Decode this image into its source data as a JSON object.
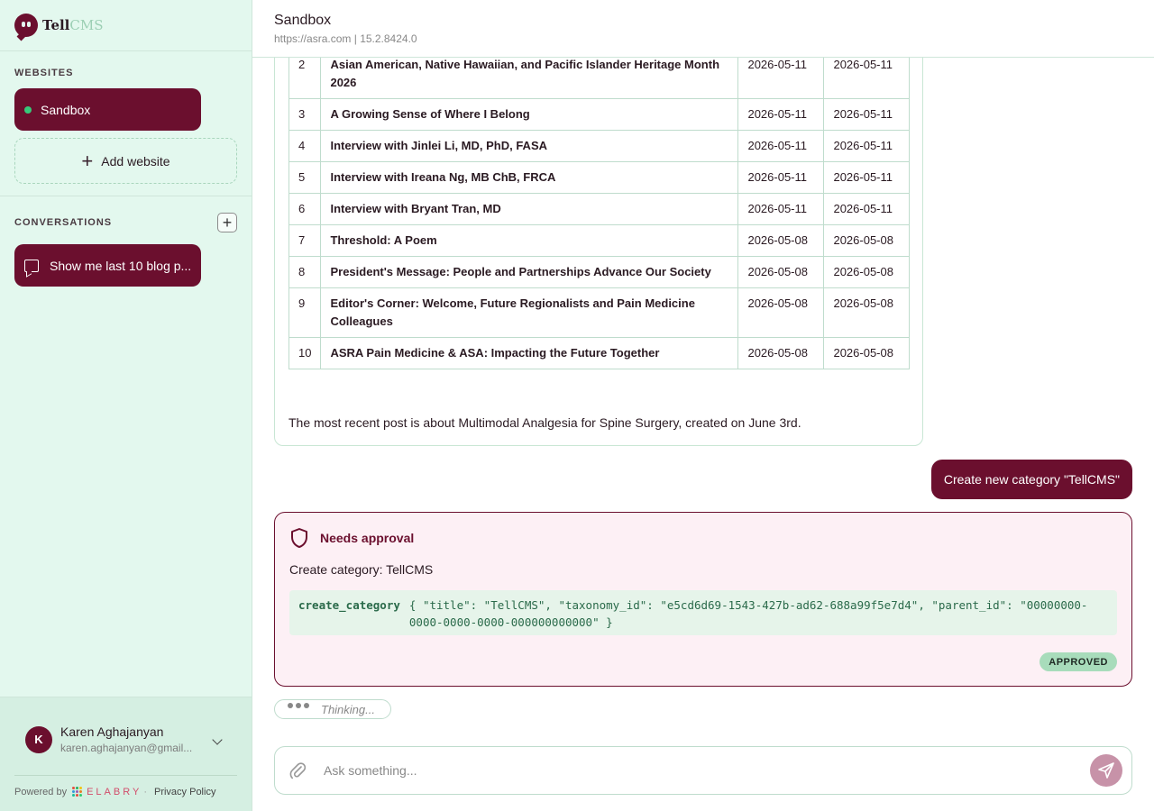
{
  "brand": {
    "name_a": "Tell",
    "name_b": "CMS"
  },
  "sidebar": {
    "websites_title": "WEBSITES",
    "websites": [
      {
        "label": "Sandbox",
        "status_color": "#37c97a"
      }
    ],
    "add_website_label": "Add website",
    "conversations_title": "CONVERSATIONS",
    "conversations": [
      {
        "label": "Show me last 10 blog p..."
      }
    ]
  },
  "user": {
    "initial": "K",
    "name": "Karen Aghajanyan",
    "email": "karen.aghajanyan@gmail..."
  },
  "footer": {
    "powered_by": "Powered by",
    "company": "ELABRY",
    "privacy": "Privacy Policy"
  },
  "header": {
    "title": "Sandbox",
    "url": "https://asra.com",
    "separator": "|",
    "version": "15.2.8424.0"
  },
  "posts_table": {
    "rows": [
      {
        "num": "2",
        "title": "Asian American, Native Hawaiian, and Pacific Islander Heritage Month 2026",
        "created": "2026-05-11",
        "modified": "2026-05-11"
      },
      {
        "num": "3",
        "title": "A Growing Sense of Where I Belong",
        "created": "2026-05-11",
        "modified": "2026-05-11"
      },
      {
        "num": "4",
        "title": "Interview with Jinlei Li, MD, PhD, FASA",
        "created": "2026-05-11",
        "modified": "2026-05-11"
      },
      {
        "num": "5",
        "title": "Interview with Ireana Ng, MB ChB, FRCA",
        "created": "2026-05-11",
        "modified": "2026-05-11"
      },
      {
        "num": "6",
        "title": "Interview with Bryant Tran, MD",
        "created": "2026-05-11",
        "modified": "2026-05-11"
      },
      {
        "num": "7",
        "title": "Threshold: A Poem",
        "created": "2026-05-08",
        "modified": "2026-05-08"
      },
      {
        "num": "8",
        "title": "President's Message: People and Partnerships Advance Our Society",
        "created": "2026-05-08",
        "modified": "2026-05-08"
      },
      {
        "num": "9",
        "title": "Editor's Corner: Welcome, Future Regionalists and Pain Medicine Colleagues",
        "created": "2026-05-08",
        "modified": "2026-05-08"
      },
      {
        "num": "10",
        "title": "ASRA Pain Medicine & ASA: Impacting the Future Together",
        "created": "2026-05-08",
        "modified": "2026-05-08"
      }
    ]
  },
  "assistant_summary": "The most recent post is about Multimodal Analgesia for Spine Surgery, created on June 3rd.",
  "user_message": "Create new category \"TellCMS\"",
  "approval": {
    "title": "Needs approval",
    "description": "Create category: TellCMS",
    "function": "create_category",
    "args": "{ \"title\": \"TellCMS\", \"taxonomy_id\": \"e5cd6d69-1543-427b-ad62-688a99f5e7d4\", \"parent_id\": \"00000000-0000-0000-0000-000000000000\" }",
    "status": "APPROVED"
  },
  "thinking_label": "Thinking...",
  "composer": {
    "placeholder": "Ask something..."
  },
  "colors": {
    "accent": "#6b0f2e",
    "sidebar_bg": "#e3f8ee",
    "approved_badge": "#a8dcbb"
  }
}
